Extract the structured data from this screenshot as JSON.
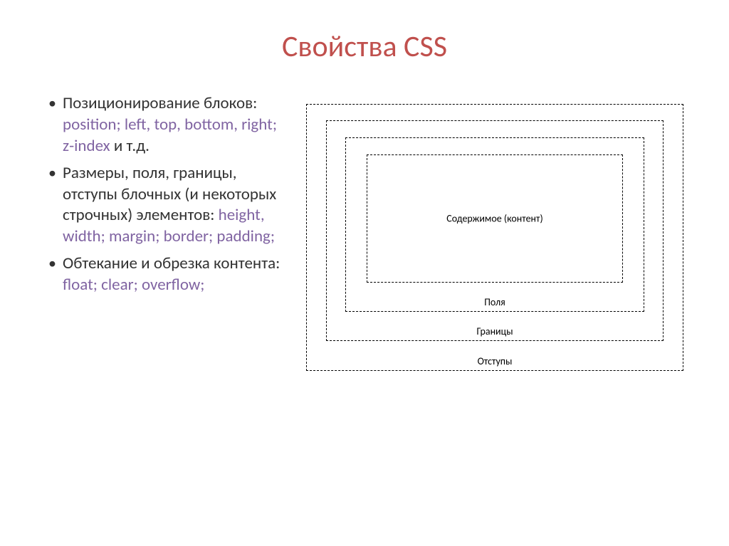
{
  "title": "Свойства CSS",
  "bullets": [
    {
      "text_before": "Позиционирование блоков: ",
      "css_part": "position; left, top, bottom, right; z-index",
      "text_after": " и т.д."
    },
    {
      "text_before": "Размеры, поля, границы, отступы блочных  (и некоторых строчных) элементов: ",
      "css_part": "height, width; margin; border; padding;",
      "text_after": ""
    },
    {
      "text_before": "Обтекание и обрезка контента: ",
      "css_part": "float; clear; overflow;",
      "text_after": ""
    }
  ],
  "diagram": {
    "margin_label": "Отступы",
    "border_label": "Границы",
    "padding_label": "Поля",
    "content_label": "Содержимое (контент)"
  }
}
